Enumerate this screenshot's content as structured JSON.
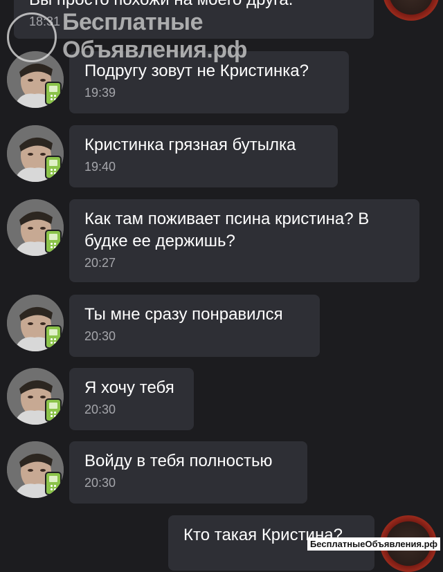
{
  "watermark": {
    "line1": "Бесплатные",
    "line2": "Объявления.рф",
    "footer": "БесплатныеОбъявления.рф"
  },
  "top_message": {
    "text": "Вы просто похожи на моего друга.",
    "time": "18:31"
  },
  "messages": [
    {
      "text": "Подругу зовут не Кристинка?",
      "time": "19:39"
    },
    {
      "text": "Кристинка грязная бутылка",
      "time": "19:40"
    },
    {
      "text": "Как там поживает псина кристина? В\nбудке ее держишь?",
      "time": "20:27"
    },
    {
      "text": "Ты мне сразу понравился",
      "time": "20:30"
    },
    {
      "text": "Я хочу тебя",
      "time": "20:30"
    },
    {
      "text": "Войду в тебя полностью",
      "time": "20:30"
    }
  ],
  "outgoing": {
    "text": "Кто такая Кристина?"
  },
  "colors": {
    "background": "#1c1c1f",
    "bubble": "#2e2f35",
    "time": "#a5a6ab",
    "badge": "#8bc34a"
  },
  "icons": {
    "badge": "mobile-phone-icon"
  }
}
